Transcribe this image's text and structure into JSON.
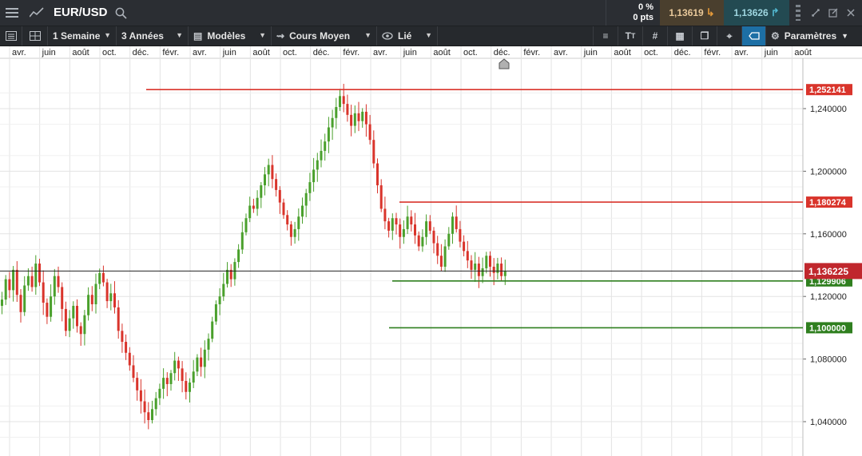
{
  "app": {
    "symbol": "EUR/USD",
    "change_pct": "0 %",
    "change_pts": "0 pts",
    "sell_price": "1,13619",
    "buy_price": "1,13626"
  },
  "toolbar": {
    "period": "1 Semaine",
    "range": "3 Années",
    "models": "Modèles",
    "average": "Cours Moyen",
    "linked": "Lié",
    "settings": "Paramètres"
  },
  "icons": {
    "menu": "hamburger-icon",
    "chart": "line-chart-icon",
    "search": "search-icon",
    "sell_arrow": "arrow-down-icon",
    "buy_arrow": "arrow-up-icon",
    "text_tool": "text-size-icon",
    "grid_tool": "crosshair-grid-icon",
    "settings": "gear-icon"
  },
  "colors": {
    "up": "#4aa02c",
    "down": "#d9342b",
    "resistance": "#d9342b",
    "support": "#2f7f1f",
    "current_tag": "#c0272d",
    "grid": "#e3e3e3"
  },
  "chart_data": {
    "type": "candlestick",
    "instrument": "EUR/USD",
    "interval": "1 Semaine",
    "x_tick_labels": [
      "avr.",
      "juin",
      "août",
      "oct.",
      "déc.",
      "févr.",
      "avr.",
      "juin",
      "août",
      "oct.",
      "déc.",
      "févr.",
      "avr.",
      "juin",
      "août",
      "oct.",
      "déc.",
      "févr.",
      "avr.",
      "juin",
      "août",
      "oct.",
      "déc.",
      "févr.",
      "avr.",
      "juin",
      "août"
    ],
    "y_ticks": [
      "1,240000",
      "1,200000",
      "1,160000",
      "1,120000",
      "1,080000",
      "1,040000"
    ],
    "ylim": [
      1.02,
      1.27
    ],
    "levels": [
      {
        "label": "1,252141",
        "value": 1.252141,
        "kind": "resistance"
      },
      {
        "label": "1,180274",
        "value": 1.180274,
        "kind": "resistance"
      },
      {
        "label": "1,129906",
        "value": 1.129906,
        "kind": "support"
      },
      {
        "label": "1,100000",
        "value": 1.1,
        "kind": "support"
      }
    ],
    "current": {
      "label": "1,136225",
      "value": 1.136225
    },
    "weekly_closes": [
      1.118,
      1.131,
      1.124,
      1.137,
      1.121,
      1.11,
      1.127,
      1.133,
      1.126,
      1.141,
      1.129,
      1.116,
      1.107,
      1.12,
      1.133,
      1.126,
      1.112,
      1.098,
      1.106,
      1.114,
      1.101,
      1.096,
      1.108,
      1.121,
      1.115,
      1.128,
      1.135,
      1.129,
      1.117,
      1.122,
      1.113,
      1.098,
      1.091,
      1.084,
      1.076,
      1.068,
      1.06,
      1.053,
      1.046,
      1.041,
      1.048,
      1.055,
      1.061,
      1.068,
      1.064,
      1.071,
      1.079,
      1.074,
      1.066,
      1.059,
      1.065,
      1.072,
      1.081,
      1.075,
      1.086,
      1.093,
      1.104,
      1.115,
      1.12,
      1.128,
      1.137,
      1.131,
      1.142,
      1.15,
      1.161,
      1.17,
      1.178,
      1.176,
      1.183,
      1.191,
      1.198,
      1.204,
      1.195,
      1.188,
      1.18,
      1.172,
      1.166,
      1.158,
      1.163,
      1.171,
      1.178,
      1.186,
      1.193,
      1.201,
      1.207,
      1.213,
      1.219,
      1.228,
      1.234,
      1.241,
      1.248,
      1.243,
      1.236,
      1.229,
      1.237,
      1.232,
      1.238,
      1.23,
      1.22,
      1.205,
      1.191,
      1.176,
      1.168,
      1.162,
      1.17,
      1.166,
      1.158,
      1.163,
      1.171,
      1.166,
      1.159,
      1.152,
      1.158,
      1.168,
      1.162,
      1.154,
      1.146,
      1.139,
      1.152,
      1.16,
      1.171,
      1.163,
      1.155,
      1.149,
      1.143,
      1.137,
      1.141,
      1.133,
      1.138,
      1.146,
      1.139,
      1.135,
      1.141,
      1.133,
      1.136
    ]
  }
}
